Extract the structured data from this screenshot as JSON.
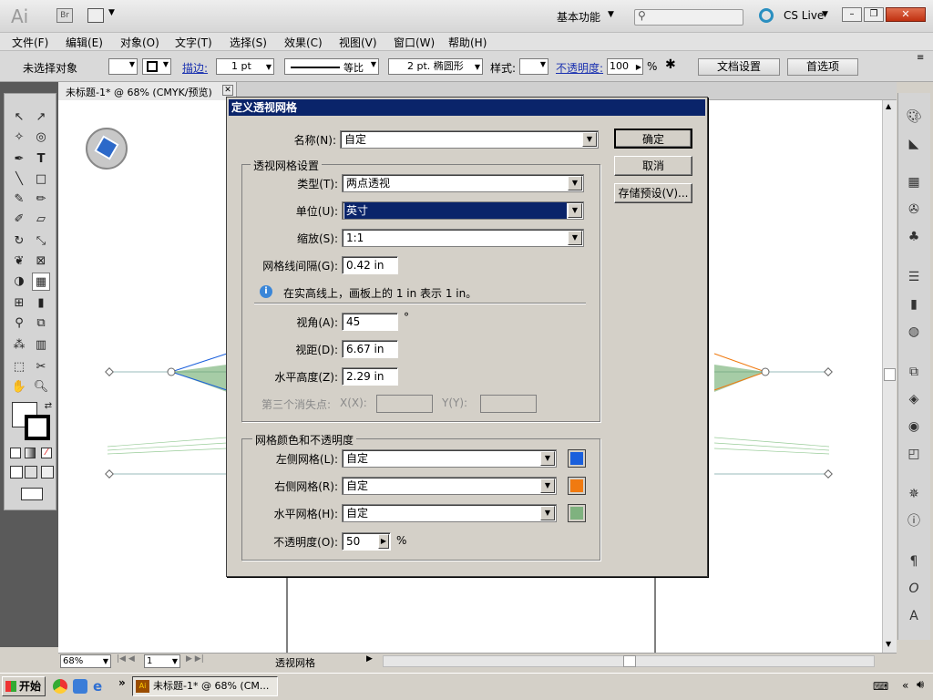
{
  "app": {
    "logo": "Ai",
    "bridge": "Br",
    "workspace": "基本功能",
    "search_placeholder": "",
    "cs_live": "CS Live"
  },
  "menu": [
    "文件(F)",
    "编辑(E)",
    "对象(O)",
    "文字(T)",
    "选择(S)",
    "效果(C)",
    "视图(V)",
    "窗口(W)",
    "帮助(H)"
  ],
  "control": {
    "no_selection": "未选择对象",
    "stroke_label": "描边:",
    "stroke_value": "1 pt",
    "stroke_style": "等比",
    "brush": "2 pt. 椭圆形",
    "style_label": "样式:",
    "opacity_label": "不透明度:",
    "opacity_value": "100",
    "opacity_unit": "%",
    "doc_settings": "文档设置",
    "preferences": "首选项"
  },
  "doc_tab": "未标题-1* @ 68% (CMYK/预览)",
  "status": {
    "zoom": "68%",
    "page": "1",
    "tool_name": "透视网格"
  },
  "dialog": {
    "title": "定义透视网格",
    "name_label": "名称(N):",
    "name_value": "自定",
    "ok": "确定",
    "cancel": "取消",
    "save_preset": "存储预设(V)...",
    "grid_settings_title": "透视网格设置",
    "type_label": "类型(T):",
    "type_value": "两点透视",
    "unit_label": "单位(U):",
    "unit_value": "英寸",
    "scale_label": "缩放(S):",
    "scale_value": "1:1",
    "gridline_label": "网格线间隔(G):",
    "gridline_value": "0.42 in",
    "info_text": "在实高线上，画板上的 1 in 表示 1 in。",
    "angle_label": "视角(A):",
    "angle_value": "45",
    "angle_unit": "°",
    "distance_label": "视距(D):",
    "distance_value": "6.67 in",
    "horizon_label": "水平高度(Z):",
    "horizon_value": "2.29 in",
    "third_vp_label": "第三个消失点:",
    "x_label": "X(X):",
    "y_label": "Y(Y):",
    "color_title": "网格颜色和不透明度",
    "left_label": "左侧网格(L):",
    "left_value": "自定",
    "left_color": "#1a5fdc",
    "right_label": "右侧网格(R):",
    "right_value": "自定",
    "right_color": "#f07a10",
    "hgrid_label": "水平网格(H):",
    "hgrid_value": "自定",
    "hgrid_color": "#7fb27f",
    "opacity_label": "不透明度(O):",
    "opacity_value": "50",
    "opacity_unit": "%"
  },
  "taskbar": {
    "start": "开始",
    "window": "未标题-1* @ 68% (CM..."
  }
}
